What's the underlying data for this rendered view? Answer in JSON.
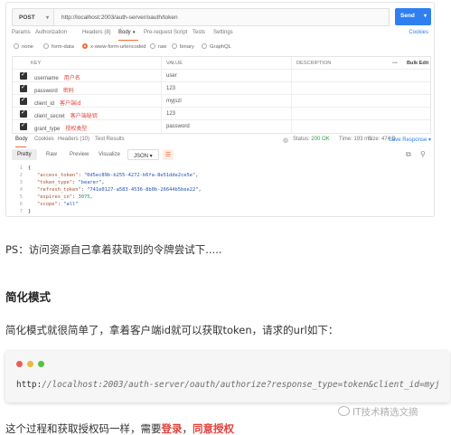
{
  "request": {
    "method": "POST",
    "url": "http://localhost:2003/auth-server/oauth/token",
    "send_label": "Send",
    "tabs": [
      {
        "label": "Params"
      },
      {
        "label": "Authorization"
      },
      {
        "label": "Headers (8)"
      },
      {
        "label": "Body"
      },
      {
        "label": "Pre-request Script"
      },
      {
        "label": "Tests"
      },
      {
        "label": "Settings"
      }
    ],
    "cookies_label": "Cookies",
    "body_types": [
      {
        "label": "none",
        "selected": false
      },
      {
        "label": "form-data",
        "selected": false
      },
      {
        "label": "x-www-form-urlencoded",
        "selected": true
      },
      {
        "label": "raw",
        "selected": false
      },
      {
        "label": "binary",
        "selected": false
      },
      {
        "label": "GraphQL",
        "selected": false
      }
    ],
    "table": {
      "headers": [
        "KEY",
        "VALUE",
        "DESCRIPTION",
        "Bulk Edit"
      ],
      "rows": [
        {
          "key": "username",
          "note": "用户名",
          "value": "user"
        },
        {
          "key": "password",
          "note": "密码",
          "value": "123"
        },
        {
          "key": "client_id",
          "note": "客户端id",
          "value": "myjszl"
        },
        {
          "key": "client_secret",
          "note": "客户端秘钥",
          "value": "123"
        },
        {
          "key": "grant_type",
          "note": "授权类型",
          "value": "password"
        }
      ]
    }
  },
  "response": {
    "tabs": [
      {
        "label": "Body"
      },
      {
        "label": "Cookies"
      },
      {
        "label": "Headers (10)"
      },
      {
        "label": "Test Results"
      }
    ],
    "status_label": "Status:",
    "status_value": "200 OK",
    "time": "Time: 193 ms",
    "size": "Size: 474 B",
    "save_label": "Save Response",
    "format_tabs": [
      "Pretty",
      "Raw",
      "Preview",
      "Visualize"
    ],
    "format_select": "JSON",
    "json_lines": [
      {
        "n": "1",
        "text": "{"
      },
      {
        "n": "2",
        "key": "\"access_token\"",
        "val": "\"0d5ec89b-b255-4272-b6fa-8e51dde2ce5e\"",
        "type": "str"
      },
      {
        "n": "3",
        "key": "\"token_type\"",
        "val": "\"bearer\"",
        "type": "str"
      },
      {
        "n": "4",
        "key": "\"refresh_token\"",
        "val": "\"741e0127-a583-4536-8b0b-26644b5bee22\"",
        "type": "str"
      },
      {
        "n": "5",
        "key": "\"expires_in\"",
        "val": "3075",
        "type": "num"
      },
      {
        "n": "6",
        "key": "\"scope\"",
        "val": "\"all\"",
        "type": "str"
      },
      {
        "n": "7",
        "text": "}"
      }
    ]
  },
  "article": {
    "para1": "PS：访问资源自己拿着获取到的令牌尝试下.....",
    "heading": "简化模式",
    "para2": "简化模式就很简单了，拿着客户端id就可以获取token，请求的url如下：",
    "code_prefix": "http:",
    "code_rest": "//localhost:2003/auth-server/oauth/authorize?response_type=token&client_id=myj",
    "para3_a": "这个过程和获取授权码一样，需要",
    "para3_login": "登录",
    "para3_sep": "，",
    "para3_consent": "同意授权",
    "watermark": "IT技术精选文摘"
  }
}
